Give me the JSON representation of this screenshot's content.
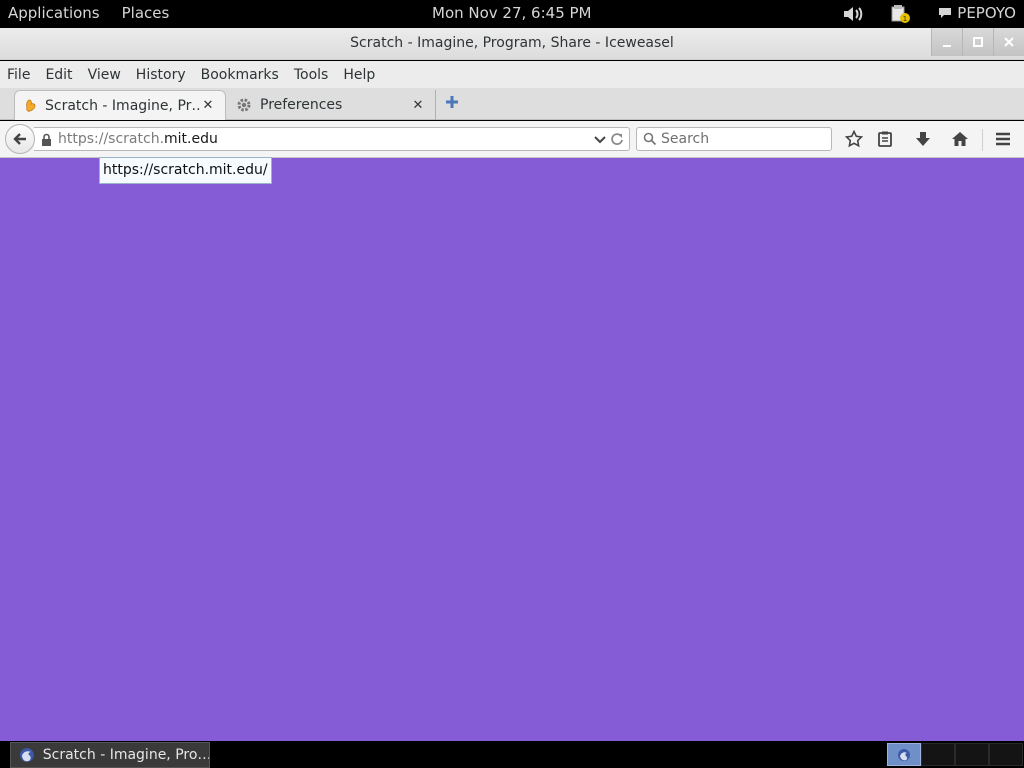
{
  "top_panel": {
    "applications": "Applications",
    "places": "Places",
    "clock": "Mon Nov 27,  6:45 PM",
    "user": "PEPOYO",
    "icons": [
      "volume-icon",
      "notification-icon",
      "chat-icon"
    ]
  },
  "window": {
    "title": "Scratch - Imagine, Program, Share - Iceweasel",
    "controls": [
      "minimize",
      "maximize",
      "close"
    ]
  },
  "menubar": {
    "items": [
      {
        "label": "File",
        "accel": "F"
      },
      {
        "label": "Edit",
        "accel": "E"
      },
      {
        "label": "View",
        "accel": "V"
      },
      {
        "label": "History",
        "accel": "s"
      },
      {
        "label": "Bookmarks",
        "accel": "B"
      },
      {
        "label": "Tools",
        "accel": "T"
      },
      {
        "label": "Help",
        "accel": "H"
      }
    ]
  },
  "tabs": [
    {
      "label": "Scratch - Imagine, Pr…",
      "icon": "scratch-favicon",
      "active": true
    },
    {
      "label": "Preferences",
      "icon": "gear-icon",
      "active": false
    }
  ],
  "navbar": {
    "url_scheme": "https://scratch.",
    "url_host": "mit.edu",
    "search_placeholder": "Search"
  },
  "content": {
    "background": "#855cd6",
    "tooltip": "https://scratch.mit.edu/"
  },
  "taskbar": {
    "task_label": "Scratch - Imagine, Pro…",
    "workspaces": 4,
    "active_workspace": 1
  }
}
